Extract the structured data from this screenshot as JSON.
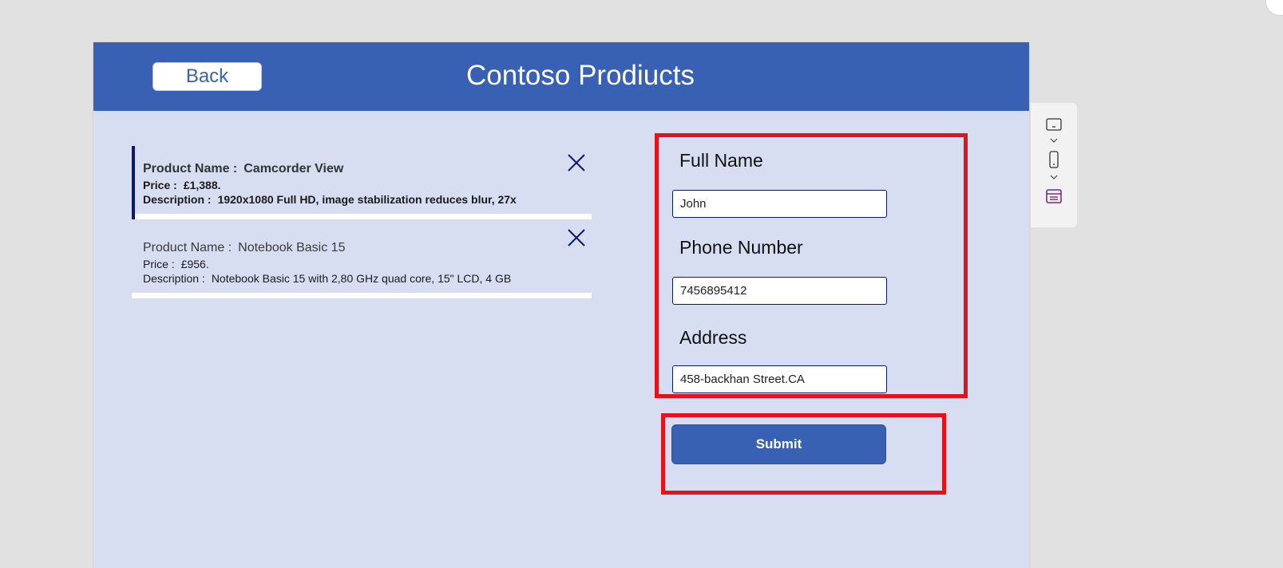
{
  "header": {
    "back_label": "Back",
    "title": "Contoso Prodiucts"
  },
  "gallery": {
    "items": [
      {
        "name_label": "Product Name :",
        "name": "Camcorder View",
        "price_label": "Price  :",
        "price": "£1,388.",
        "description_label": "Description  :",
        "description": "1920x1080 Full HD, image stabilization reduces blur, 27x",
        "selected": true
      },
      {
        "name_label": "Product Name :",
        "name": "Notebook Basic 15",
        "price_label": "Price  :",
        "price": "£956.",
        "description_label": "Description  :",
        "description": "Notebook Basic 15 with 2,80 GHz quad core, 15\" LCD, 4 GB",
        "selected": false
      }
    ],
    "delete_icon": "close-x-icon"
  },
  "form": {
    "full_name": {
      "label": "Full Name",
      "value": "John"
    },
    "phone": {
      "label": "Phone Number",
      "value": "7456895412"
    },
    "address": {
      "label": "Address",
      "value": "458-backhan Street.CA"
    },
    "submit_label": "Submit"
  },
  "side_toolbar": {
    "icons": [
      "tablet-layout-icon",
      "chevron-down-icon",
      "phone-layout-icon",
      "chevron-down-icon",
      "form-icon"
    ]
  },
  "colors": {
    "header": "#3861b4",
    "canvas": "#d8def1",
    "highlight": "#e3131b",
    "accent_dark": "#0b1a6e",
    "form_icon": "#7a2a7e"
  }
}
